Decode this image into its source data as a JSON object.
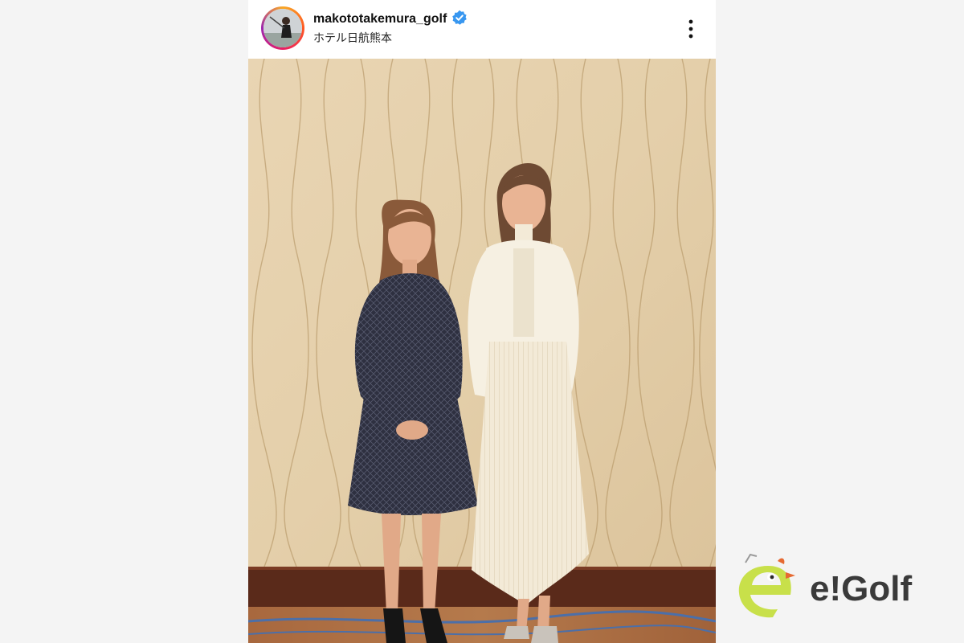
{
  "post": {
    "username": "makototakemura_golf",
    "location": "ホテル日航熊本",
    "verified": true,
    "verified_color": "#3897f0"
  },
  "icons": {
    "verified": "verified-badge-icon",
    "more": "more-vertical-icon"
  },
  "brand": {
    "logo_text": "e!Golf",
    "mascot_color": "#c8e04a",
    "text_color": "#3a3a3a"
  }
}
